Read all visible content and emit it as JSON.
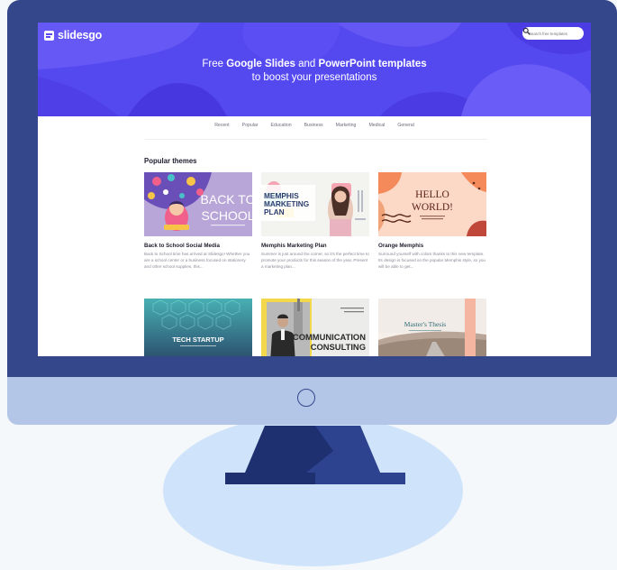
{
  "colors": {
    "bg": "#f4f8fa",
    "bezel": "#34478a",
    "chin": "#b4c6e8",
    "stand_base": "#cfe3fb",
    "stand_dark": "#1e3070",
    "stand_mid": "#2d4390",
    "accent": "#5a4bf0"
  },
  "header": {
    "logo_text": "slidesgo",
    "search_placeholder": "Search free templates",
    "title_line1_pre": "Free ",
    "title_line1_b1": "Google Slides",
    "title_line1_mid": " and ",
    "title_line1_b2": "PowerPoint templates",
    "title_line2": "to boost your presentations"
  },
  "nav": {
    "items": [
      "Recent",
      "Popular",
      "Education",
      "Business",
      "Marketing",
      "Medical",
      "General"
    ]
  },
  "main": {
    "section_title": "Popular themes",
    "cards": [
      {
        "title": "Back to School Social Media",
        "description": "Back to School time has arrived at Slidesgo! Whether you are a school center or a business focused on stationery and other school supplies, this...",
        "thumb_line1": "BACK TO",
        "thumb_line2": "SCHOOL"
      },
      {
        "title": "Memphis Marketing Plan",
        "description": "Summer is just around the corner, so it's the perfect time to promote your products for this season of the year. Present a marketing plan...",
        "thumb_line1": "MEMPHIS",
        "thumb_line2": "MARKETING",
        "thumb_line3": "PLAN"
      },
      {
        "title": "Orange Memphis",
        "description": "Surround yourself with colors thanks to this new template. Its design is focused on the popular Memphis style, so you will be able to get...",
        "thumb_line1": "HELLO",
        "thumb_line2": "WORLD!"
      },
      {
        "title": "",
        "description": "",
        "thumb_line1": "TECH STARTUP"
      },
      {
        "title": "",
        "description": "",
        "thumb_line1": "COMMUNICATION",
        "thumb_line2": "CONSULTING"
      },
      {
        "title": "",
        "description": "",
        "thumb_line1": "Master's Thesis"
      }
    ]
  }
}
